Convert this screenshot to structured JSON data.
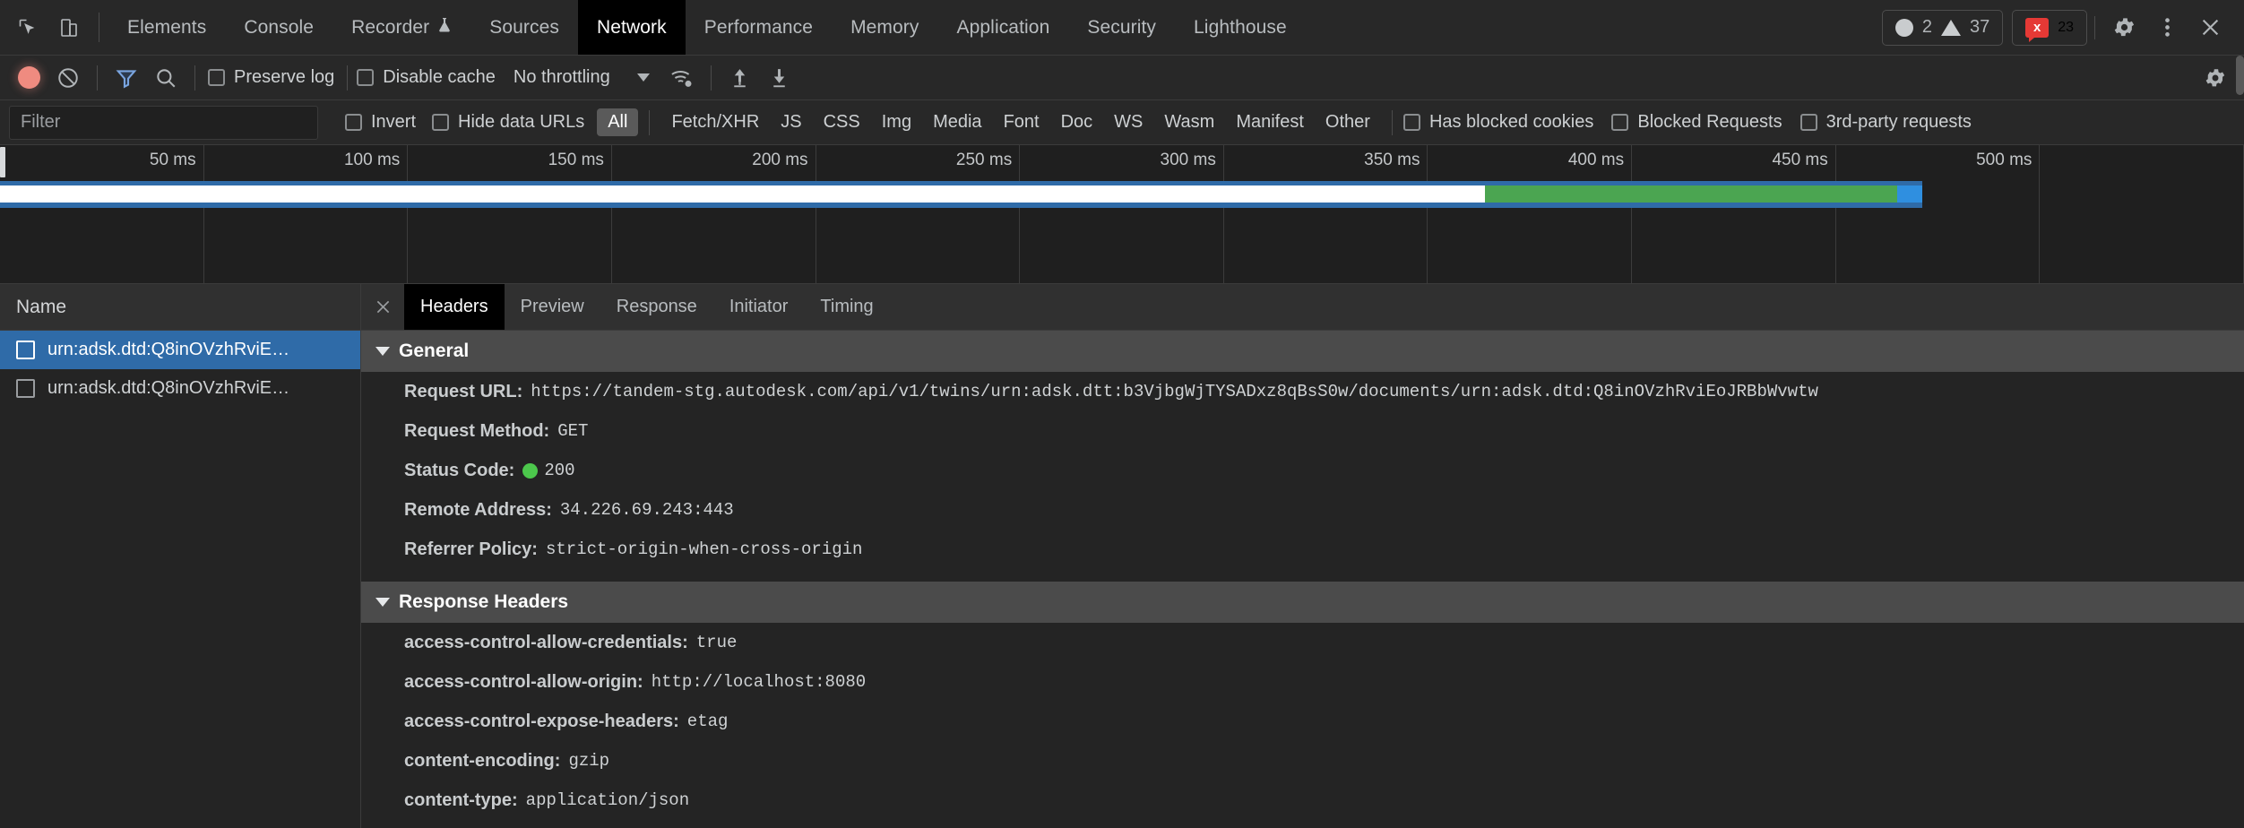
{
  "window": {
    "theme_bg": "#242424",
    "accent_blue": "#2f6ba8",
    "active_tab_bg": "#000000"
  },
  "main_tabbar": {
    "icons": [
      {
        "name": "inspect-element-icon",
        "glyph": "cursor-box"
      },
      {
        "name": "device-toolbar-icon",
        "glyph": "device"
      }
    ],
    "tabs": [
      {
        "label": "Elements",
        "active": false,
        "has_icon": false
      },
      {
        "label": "Console",
        "active": false,
        "has_icon": false
      },
      {
        "label": "Recorder",
        "active": false,
        "has_icon": true,
        "icon": "flask-icon"
      },
      {
        "label": "Sources",
        "active": false,
        "has_icon": false
      },
      {
        "label": "Network",
        "active": true,
        "has_icon": false
      },
      {
        "label": "Performance",
        "active": false,
        "has_icon": false
      },
      {
        "label": "Memory",
        "active": false,
        "has_icon": false
      },
      {
        "label": "Application",
        "active": false,
        "has_icon": false
      },
      {
        "label": "Security",
        "active": false,
        "has_icon": false
      },
      {
        "label": "Lighthouse",
        "active": false,
        "has_icon": false
      }
    ],
    "info_count": "2",
    "warning_count": "37",
    "error_count": "23",
    "error_badge_glyph": "x",
    "settings_icon": "gear-icon",
    "more_icon": "kebab-menu-icon",
    "close_icon": "close-icon"
  },
  "net_toolbar": {
    "record_tooltip": "record-button",
    "clear_tooltip": "clear-button",
    "filter_tooltip": "filter-button",
    "search_tooltip": "search-button",
    "preserve_log": {
      "label": "Preserve log",
      "checked": false
    },
    "disable_cache": {
      "label": "Disable cache",
      "checked": false
    },
    "throttling": {
      "value": "No throttling"
    },
    "network_conditions_icon": "wifi-settings-icon",
    "import_har_icon": "upload-arrow-icon",
    "export_har_icon": "download-arrow-icon",
    "settings_icon": "gear-icon"
  },
  "filter_bar": {
    "filter_placeholder": "Filter",
    "filter_value": "",
    "invert": {
      "label": "Invert",
      "checked": false
    },
    "hide_data_urls": {
      "label": "Hide data URLs",
      "checked": false
    },
    "types": [
      {
        "label": "All",
        "active": true
      },
      {
        "label": "Fetch/XHR",
        "active": false
      },
      {
        "label": "JS",
        "active": false
      },
      {
        "label": "CSS",
        "active": false
      },
      {
        "label": "Img",
        "active": false
      },
      {
        "label": "Media",
        "active": false
      },
      {
        "label": "Font",
        "active": false
      },
      {
        "label": "Doc",
        "active": false
      },
      {
        "label": "WS",
        "active": false
      },
      {
        "label": "Wasm",
        "active": false
      },
      {
        "label": "Manifest",
        "active": false
      },
      {
        "label": "Other",
        "active": false
      }
    ],
    "has_blocked_cookies": {
      "label": "Has blocked cookies",
      "checked": false
    },
    "blocked_requests": {
      "label": "Blocked Requests",
      "checked": false
    },
    "third_party_requests": {
      "label": "3rd-party requests",
      "checked": false
    }
  },
  "overview": {
    "ticks": [
      "50 ms",
      "100 ms",
      "150 ms",
      "200 ms",
      "250 ms",
      "300 ms",
      "350 ms",
      "400 ms",
      "450 ms",
      "500 ms"
    ],
    "bar_colors": {
      "band": "#2f6ba8",
      "waiting": "#ffffff",
      "download": "#4ba551",
      "tail": "#2f8fe0"
    }
  },
  "request_list": {
    "column_header": "Name",
    "rows": [
      {
        "name": "urn:adsk.dtd:Q8inOVzhRviE…",
        "selected": true,
        "checked": false
      },
      {
        "name": "urn:adsk.dtd:Q8inOVzhRviE…",
        "selected": false,
        "checked": false
      }
    ]
  },
  "details": {
    "close_icon": "close-icon",
    "tabs": [
      {
        "label": "Headers",
        "active": true
      },
      {
        "label": "Preview",
        "active": false
      },
      {
        "label": "Response",
        "active": false
      },
      {
        "label": "Initiator",
        "active": false
      },
      {
        "label": "Timing",
        "active": false
      }
    ],
    "general": {
      "title": "General",
      "expanded": true,
      "rows": [
        {
          "key": "Request URL:",
          "value": "https://tandem-stg.autodesk.com/api/v1/twins/urn:adsk.dtt:b3VjbgWjTYSADxz8qBsS0w/documents/urn:adsk.dtd:Q8inOVzhRviEoJRBbWvwtw",
          "has_status_dot": false
        },
        {
          "key": "Request Method:",
          "value": "GET",
          "has_status_dot": false
        },
        {
          "key": "Status Code:",
          "value": "200",
          "has_status_dot": true
        },
        {
          "key": "Remote Address:",
          "value": "34.226.69.243:443",
          "has_status_dot": false
        },
        {
          "key": "Referrer Policy:",
          "value": "strict-origin-when-cross-origin",
          "has_status_dot": false
        }
      ]
    },
    "response_headers": {
      "title": "Response Headers",
      "expanded": true,
      "rows": [
        {
          "key": "access-control-allow-credentials:",
          "value": "true",
          "has_status_dot": false
        },
        {
          "key": "access-control-allow-origin:",
          "value": "http://localhost:8080",
          "has_status_dot": false
        },
        {
          "key": "access-control-expose-headers:",
          "value": "etag",
          "has_status_dot": false
        },
        {
          "key": "content-encoding:",
          "value": "gzip",
          "has_status_dot": false
        },
        {
          "key": "content-type:",
          "value": "application/json",
          "has_status_dot": false
        }
      ]
    }
  }
}
